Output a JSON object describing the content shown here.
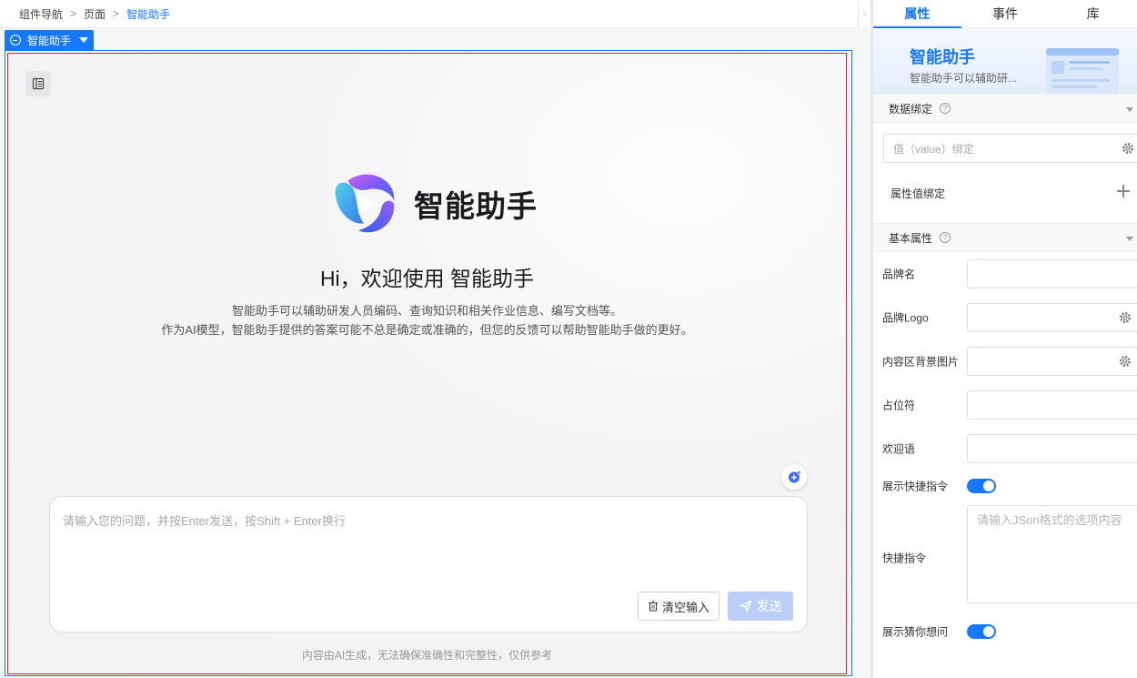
{
  "breadcrumb": [
    "组件导航",
    "页面",
    "智能助手"
  ],
  "component_tag": {
    "label": "智能助手"
  },
  "assistant": {
    "brand_name": "智能助手",
    "welcome": "Hi，欢迎使用 智能助手",
    "desc_line1": "智能助手可以辅助研发人员编码、查询知识和相关作业信息、编写文档等。",
    "desc_line2": "作为AI模型，智能助手提供的答案可能不总是确定或准确的，但您的反馈可以帮助智能助手做的更好。",
    "input_placeholder": "请输入您的问题，并按Enter发送，按Shift + Enter换行",
    "clear_label": "清空输入",
    "send_label": "发送",
    "disclaimer": "内容由AI生成，无法确保准确性和完整性，仅供参考"
  },
  "panel": {
    "tabs": [
      "属性",
      "事件",
      "库"
    ],
    "hero_title": "智能助手",
    "hero_subtitle": "智能助手可以辅助研...",
    "data_binding": {
      "title": "数据绑定",
      "value_placeholder": "值（value）绑定",
      "attr_bind_label": "属性值绑定"
    },
    "basic": {
      "title": "基本属性",
      "brand_name_label": "品牌名",
      "brand_logo_label": "品牌Logo",
      "bg_image_label": "内容区背景图片",
      "placeholder_label": "占位符",
      "welcome_label": "欢迎语",
      "show_quick_cmd_label": "展示快捷指令",
      "quick_cmd_label": "快捷指令",
      "quick_cmd_placeholder": "请输入JSon格式的选项内容",
      "show_guess_label": "展示猜你想问"
    }
  },
  "colors": {
    "accent": "#1677ff",
    "selection_red": "#e02424",
    "send_disabled": "#b9cff8"
  }
}
